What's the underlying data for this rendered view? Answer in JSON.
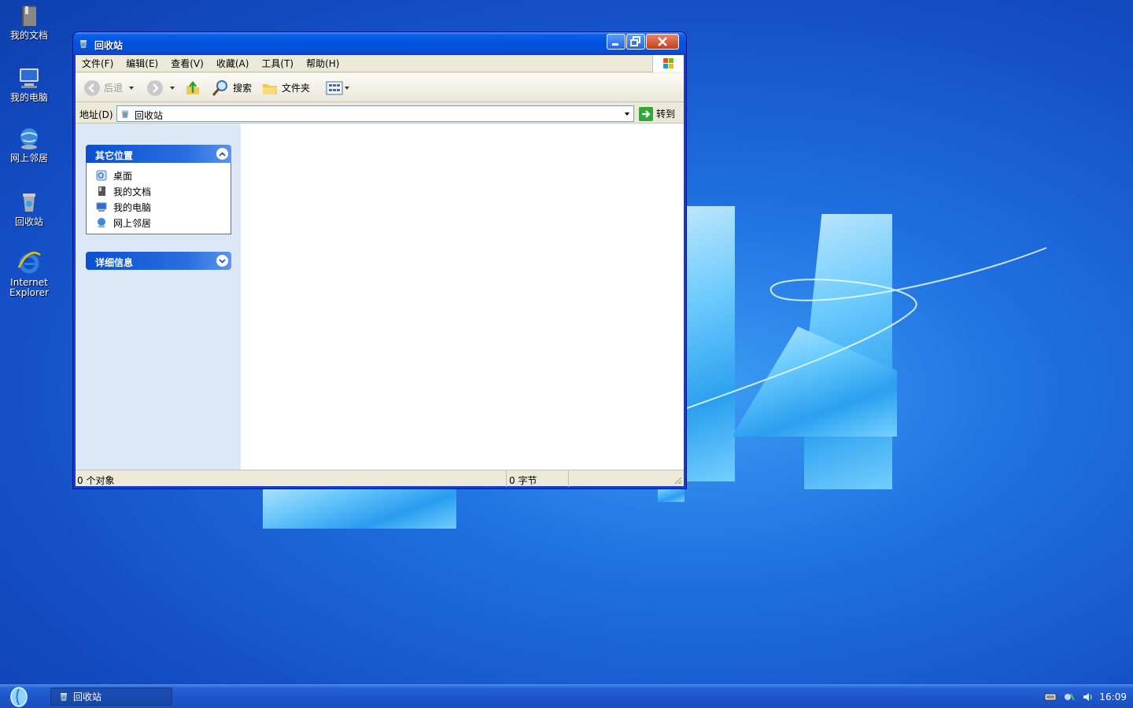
{
  "desktop": {
    "icons": [
      {
        "label": "我的文档",
        "icon": "my-documents-icon"
      },
      {
        "label": "我的电脑",
        "icon": "my-computer-icon"
      },
      {
        "label": "网上邻居",
        "icon": "network-places-icon"
      },
      {
        "label": "回收站",
        "icon": "recycle-bin-icon"
      },
      {
        "label": "Internet Explorer",
        "icon": "internet-explorer-icon"
      }
    ]
  },
  "window": {
    "title": "回收站",
    "menu": [
      "文件(F)",
      "编辑(E)",
      "查看(V)",
      "收藏(A)",
      "工具(T)",
      "帮助(H)"
    ],
    "toolbar": {
      "back_label": "后退",
      "search_label": "搜索",
      "folders_label": "文件夹"
    },
    "address": {
      "label": "地址(D)",
      "value": "回收站",
      "go_label": "转到"
    },
    "taskpane": {
      "other_places_title": "其它位置",
      "places": [
        "桌面",
        "我的文档",
        "我的电脑",
        "网上邻居"
      ],
      "details_title": "详细信息"
    },
    "status": {
      "objects": "0 个对象",
      "size": "0 字节"
    }
  },
  "taskbar": {
    "task_label": "回收站",
    "clock": "16:09"
  },
  "colors": {
    "title_blue": "#0052e0",
    "taskbar_blue": "#1c55c8",
    "pane_blue": "#dce8f8"
  }
}
